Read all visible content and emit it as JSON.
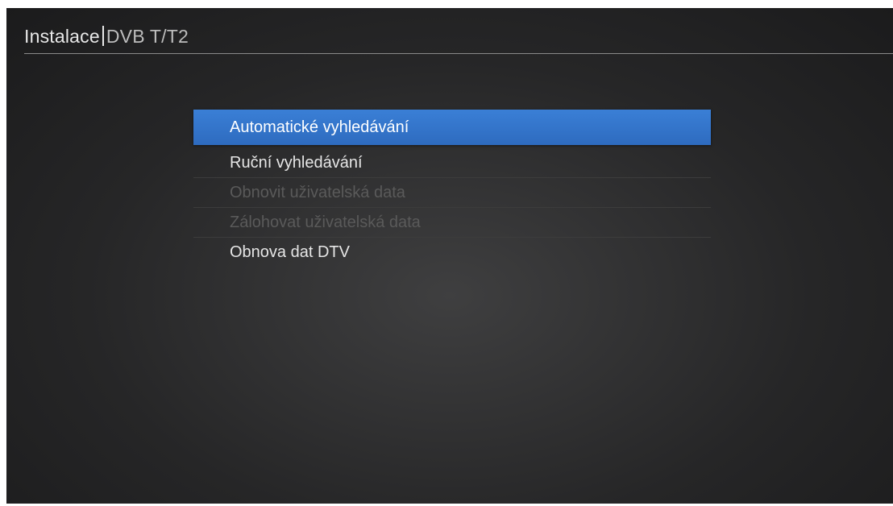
{
  "header": {
    "section": "Instalace",
    "subsection": "DVB T/T2"
  },
  "menu": {
    "items": [
      {
        "label": "Automatické vyhledávání",
        "state": "selected"
      },
      {
        "label": "Ruční vyhledávání",
        "state": "enabled"
      },
      {
        "label": "Obnovit uživatelská data",
        "state": "disabled"
      },
      {
        "label": "Zálohovat uživatelská data",
        "state": "disabled"
      },
      {
        "label": "Obnova dat DTV",
        "state": "enabled"
      }
    ]
  },
  "colors": {
    "selection": "#3a7fd6",
    "text": "#e6e6e6",
    "disabled_text": "#5a5a5a",
    "background": "#2d2d2e"
  }
}
